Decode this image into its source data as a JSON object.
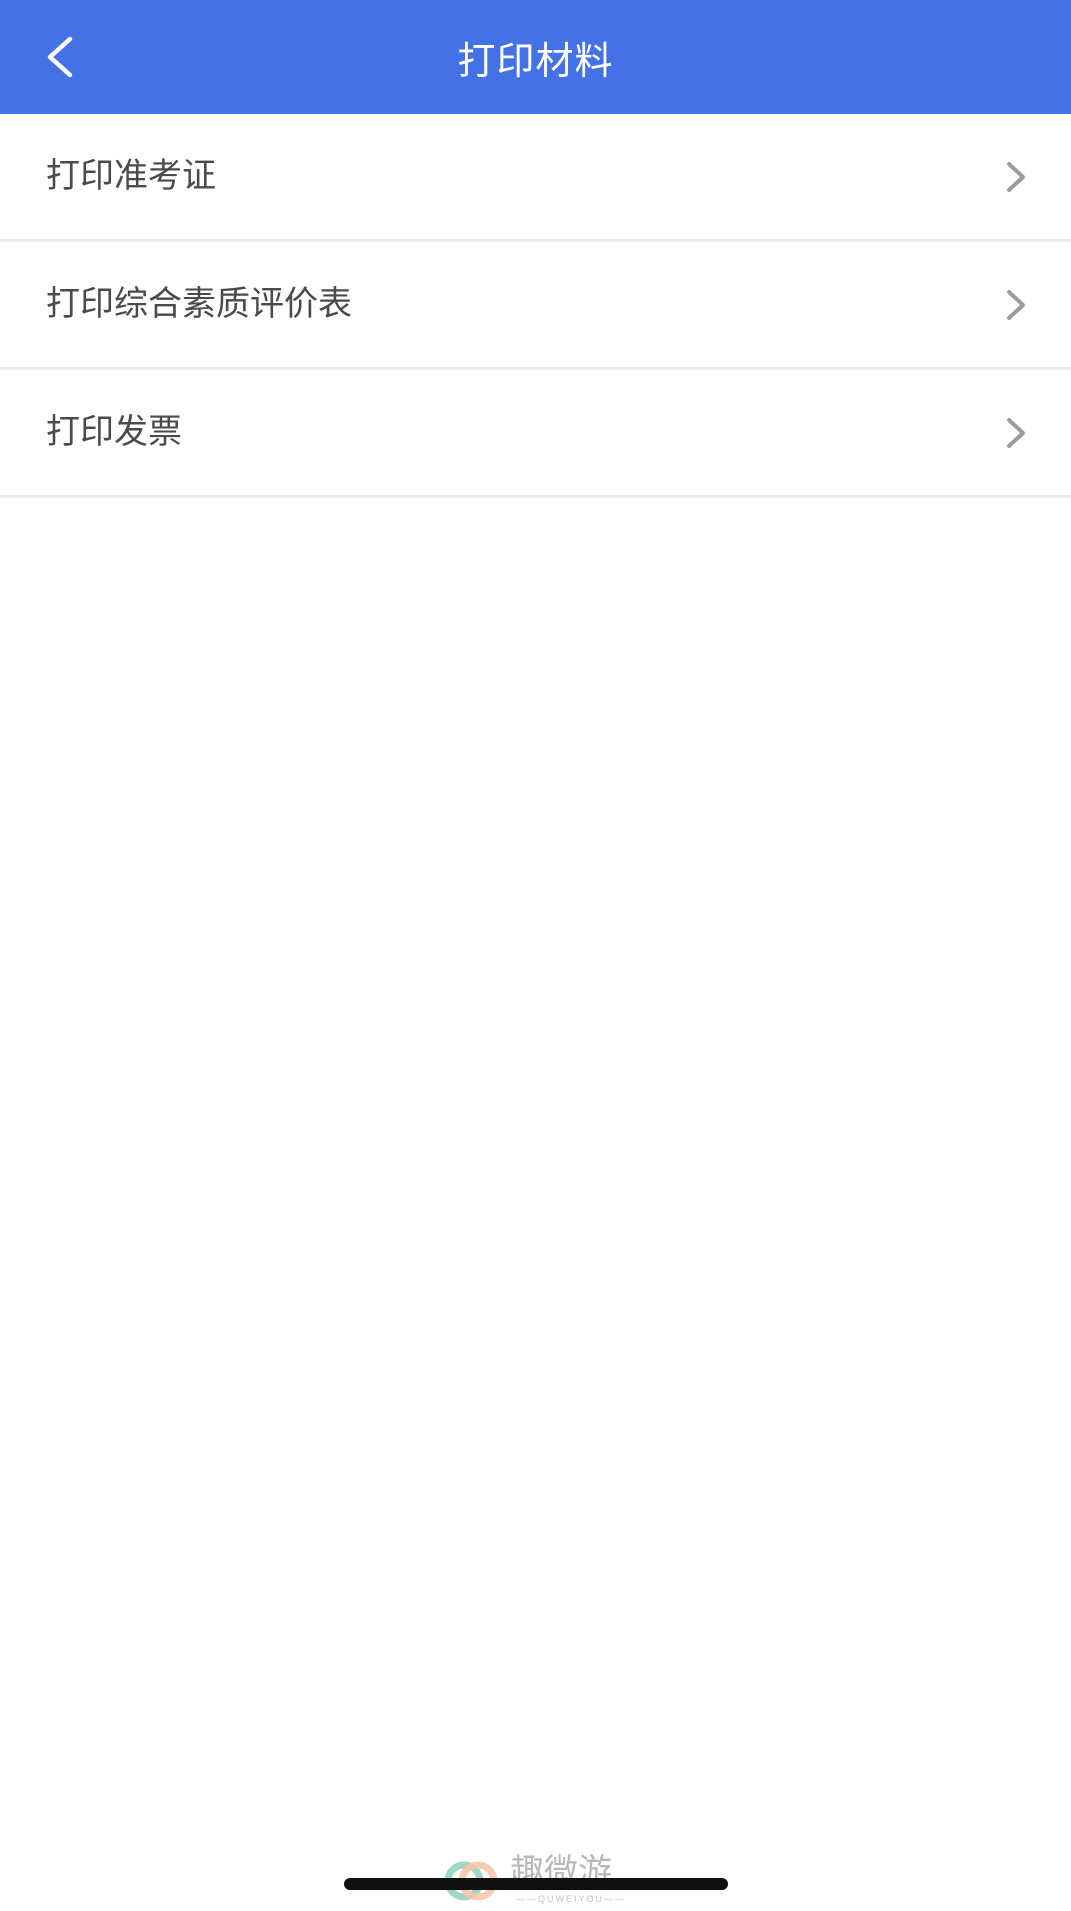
{
  "header": {
    "title": "打印材料",
    "back_icon": "chevron-left-icon"
  },
  "menu": {
    "items": [
      {
        "label": "打印准考证",
        "icon": "chevron-right-icon"
      },
      {
        "label": "打印综合素质评价表",
        "icon": "chevron-right-icon"
      },
      {
        "label": "打印发票",
        "icon": "chevron-right-icon"
      }
    ]
  },
  "watermark": {
    "text_cn": "趣微游",
    "text_en": "——QUWEIYOU——"
  },
  "colors": {
    "header_bg": "#4472E6",
    "label_text": "#4a4a4a",
    "chevron": "#9b9b9b",
    "divider": "#ececec"
  }
}
